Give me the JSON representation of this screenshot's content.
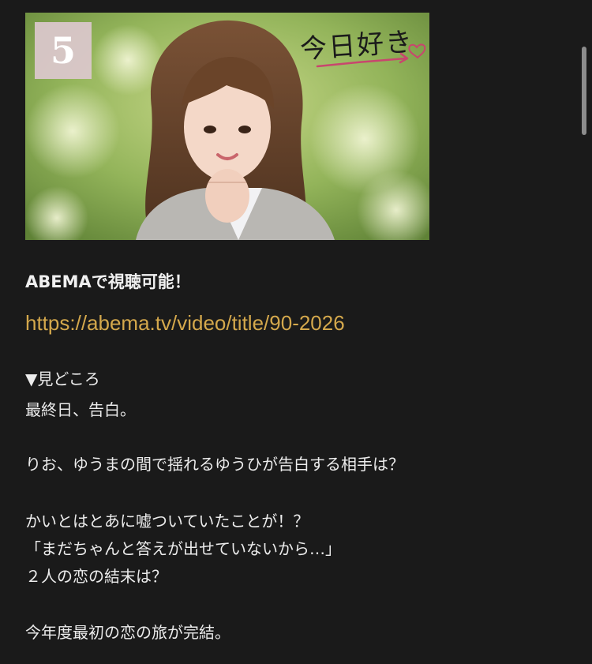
{
  "thumbnail": {
    "episode_number": "5",
    "show_logo_text": "今日好き",
    "description": "episode thumbnail"
  },
  "post": {
    "availability": "ABEMAで視聴可能！",
    "link_url": "https://abema.tv/video/title/90-2026",
    "highlights_heading": "▼見どころ",
    "lines": [
      "最終日、告白。",
      "りお、ゆうまの間で揺れるゆうひが告白する相手は？",
      "かいとはとあに嘘ついていたことが！？",
      "「まだちゃんと答えが出せていないから…」",
      "２人の恋の結末は？",
      "今年度最初の恋の旅が完結。"
    ]
  },
  "colors": {
    "background": "#1a1a1a",
    "text": "#ececec",
    "link": "#d4a84c",
    "scrollbar": "#8c8c8c"
  }
}
